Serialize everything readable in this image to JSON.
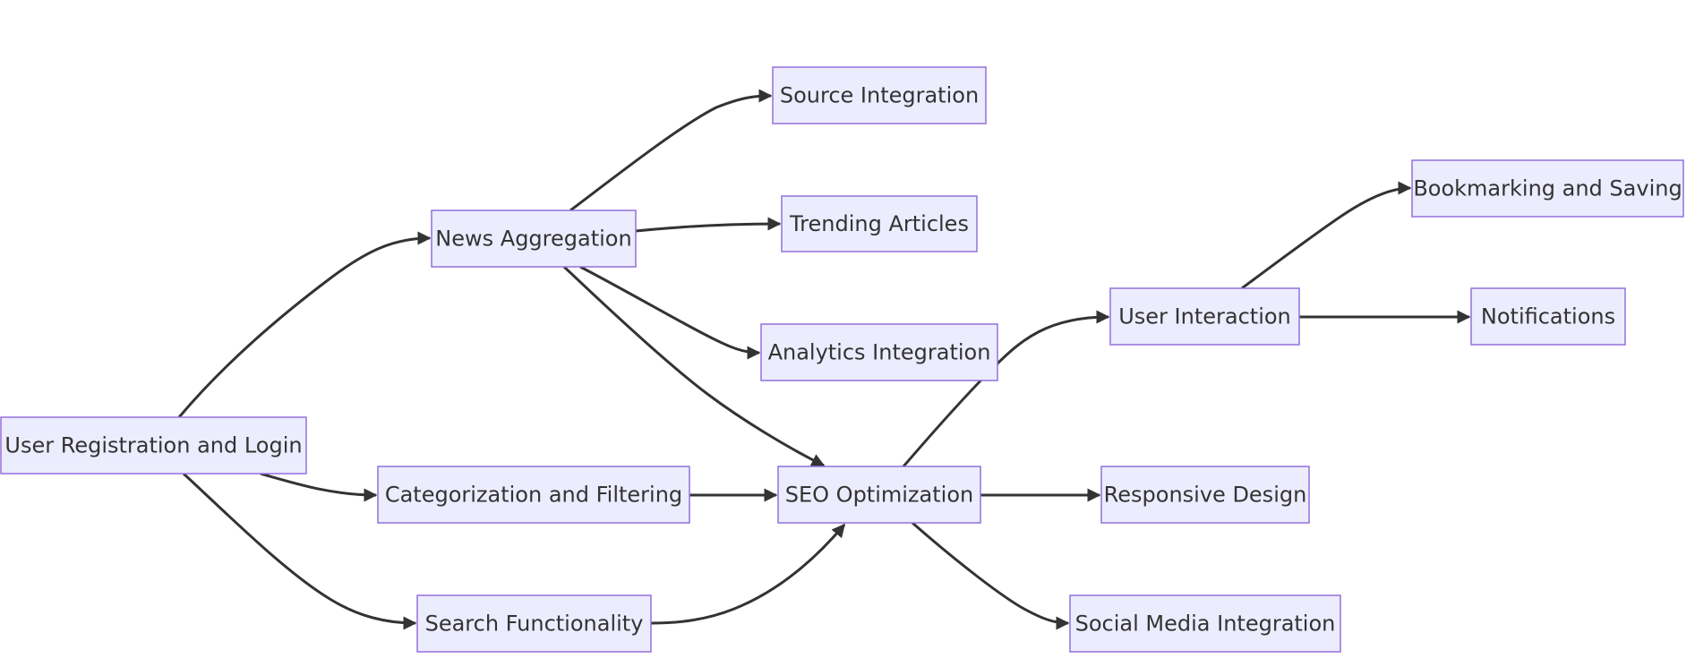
{
  "diagram": {
    "type": "flowchart",
    "direction": "left-to-right",
    "colors": {
      "node_fill": "#ECECFF",
      "node_border": "#9370DB",
      "edge": "#333333",
      "text": "#333333",
      "background": "#FFFFFF"
    },
    "nodes": [
      {
        "id": "A",
        "label": "User Registration and Login"
      },
      {
        "id": "B",
        "label": "News Aggregation"
      },
      {
        "id": "C",
        "label": "Categorization and Filtering"
      },
      {
        "id": "D",
        "label": "Search Functionality"
      },
      {
        "id": "E",
        "label": "Source Integration"
      },
      {
        "id": "F",
        "label": "Trending Articles"
      },
      {
        "id": "G",
        "label": "Analytics Integration"
      },
      {
        "id": "H",
        "label": "SEO Optimization"
      },
      {
        "id": "I",
        "label": "User Interaction"
      },
      {
        "id": "J",
        "label": "Responsive Design"
      },
      {
        "id": "K",
        "label": "Social Media Integration"
      },
      {
        "id": "L",
        "label": "Bookmarking and Saving"
      },
      {
        "id": "M",
        "label": "Notifications"
      }
    ],
    "edges": [
      {
        "from": "A",
        "to": "B"
      },
      {
        "from": "A",
        "to": "C"
      },
      {
        "from": "A",
        "to": "D"
      },
      {
        "from": "B",
        "to": "E"
      },
      {
        "from": "B",
        "to": "F"
      },
      {
        "from": "B",
        "to": "G"
      },
      {
        "from": "B",
        "to": "H"
      },
      {
        "from": "C",
        "to": "H"
      },
      {
        "from": "D",
        "to": "H"
      },
      {
        "from": "H",
        "to": "I"
      },
      {
        "from": "H",
        "to": "J"
      },
      {
        "from": "H",
        "to": "K"
      },
      {
        "from": "I",
        "to": "L"
      },
      {
        "from": "I",
        "to": "M"
      }
    ]
  }
}
